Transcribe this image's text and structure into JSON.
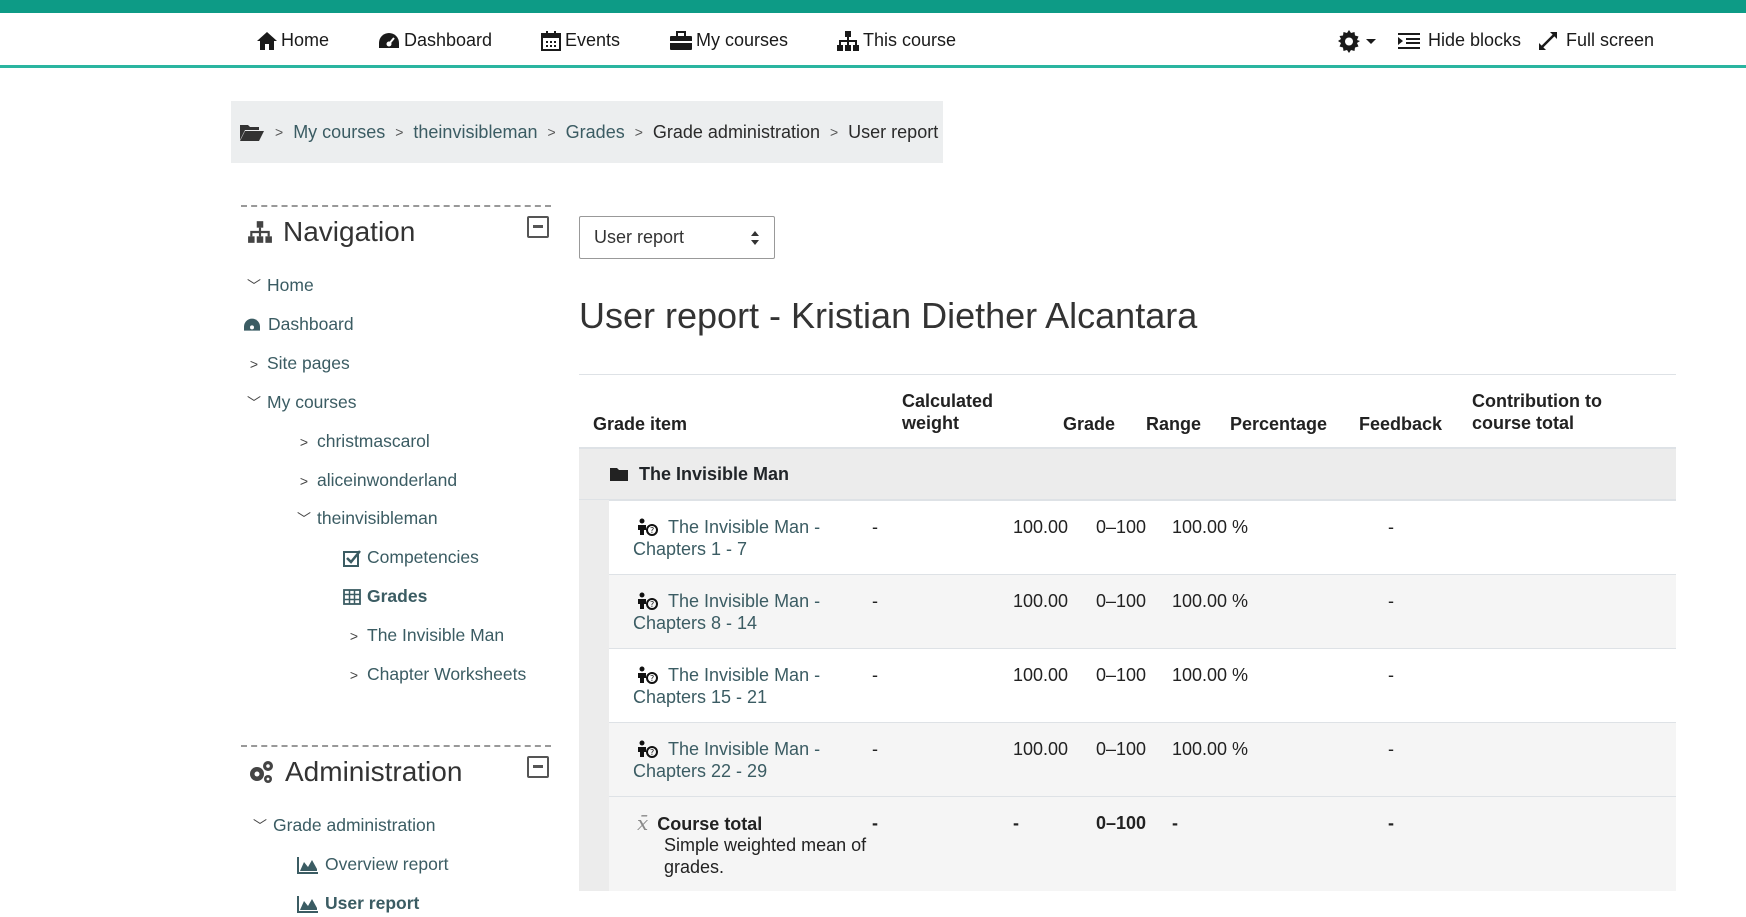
{
  "navbar": {
    "items": [
      {
        "label": "Home",
        "icon": "home-icon"
      },
      {
        "label": "Dashboard",
        "icon": "dashboard-icon"
      },
      {
        "label": "Events",
        "icon": "calendar-icon"
      },
      {
        "label": "My courses",
        "icon": "briefcase-icon"
      },
      {
        "label": "This course",
        "icon": "sitemap-icon"
      }
    ],
    "hide_blocks": "Hide blocks",
    "full_screen": "Full screen"
  },
  "breadcrumb": {
    "items": [
      "My courses",
      "theinvisibleman",
      "Grades",
      "Grade administration",
      "User report"
    ]
  },
  "navigation_block": {
    "title": "Navigation",
    "items": [
      "Home",
      "Dashboard",
      "Site pages",
      "My courses",
      "christmascarol",
      "aliceinwonderland",
      "theinvisibleman",
      "Competencies",
      "Grades",
      "The Invisible Man",
      "Chapter Worksheets"
    ]
  },
  "admin_block": {
    "title": "Administration",
    "items": [
      "Grade administration",
      "Overview report",
      "User report"
    ]
  },
  "report_select": {
    "value": "User report"
  },
  "page_title": "User report - Kristian Diether Alcantara",
  "table": {
    "headers": {
      "grade_item": "Grade item",
      "calc_weight_1": "Calculated",
      "calc_weight_2": "weight",
      "grade": "Grade",
      "range": "Range",
      "percentage": "Percentage",
      "feedback": "Feedback",
      "contribution_1": "Contribution to",
      "contribution_2": "course total"
    },
    "category": "The Invisible Man",
    "rows": [
      {
        "line1": "The Invisible Man -",
        "line2": "Chapters 1 - 7",
        "weight": "-",
        "grade": "100.00",
        "range": "0–100",
        "percentage": "100.00 %",
        "contribution": "-"
      },
      {
        "line1": "The Invisible Man -",
        "line2": "Chapters 8 - 14",
        "weight": "-",
        "grade": "100.00",
        "range": "0–100",
        "percentage": "100.00 %",
        "contribution": "-"
      },
      {
        "line1": "The Invisible Man -",
        "line2": "Chapters 15 - 21",
        "weight": "-",
        "grade": "100.00",
        "range": "0–100",
        "percentage": "100.00 %",
        "contribution": "-"
      },
      {
        "line1": "The Invisible Man -",
        "line2": "Chapters 22 - 29",
        "weight": "-",
        "grade": "100.00",
        "range": "0–100",
        "percentage": "100.00 %",
        "contribution": "-"
      }
    ],
    "total": {
      "label": "Course total",
      "desc1": "Simple weighted mean of",
      "desc2": "grades.",
      "weight": "-",
      "grade": "-",
      "range": "0–100",
      "percentage": "-",
      "contribution": "-"
    }
  },
  "colors": {
    "accent": "#0d9b86",
    "link": "#3b5c63",
    "breadcrumb_bg": "#eceeef"
  }
}
